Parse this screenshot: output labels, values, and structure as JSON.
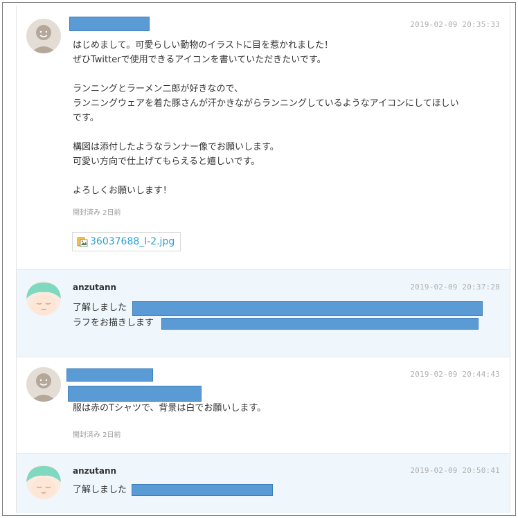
{
  "messages": [
    {
      "avatar": "default-user-avatar",
      "timestamp": "2019-02-09 20:35:33",
      "body": "はじめまして。可愛らしい動物のイラストに目を惹かれました！\nぜひTwitterで使用できるアイコンを書いていただきたいです。\n\nランニングとラーメン二郎が好きなので、\nランニングウェアを着た豚さんが汗かきながらランニングしているようなアイコンにしてほしい\nです。\n\n構図は添付したようなランナー像でお願いします。\n可愛い方向で仕上げてもらえると嬉しいです。\n\nよろしくお願いします！",
      "read_status": "開封済み 2日前",
      "attachment": {
        "icon": "image-file-icon",
        "filename": "36037688_l-2.jpg"
      }
    },
    {
      "avatar": "anzutann-avatar",
      "username": "anzutann",
      "timestamp": "2019-02-09 20:37:28",
      "lines": [
        "了解しました",
        "ラフをお描きします"
      ]
    },
    {
      "avatar": "default-user-avatar",
      "timestamp": "2019-02-09 20:44:43",
      "body": "服は赤のTシャツで、背景は白でお願いします。",
      "read_status": "開封済み 2日前"
    },
    {
      "avatar": "anzutann-avatar",
      "username": "anzutann",
      "timestamp": "2019-02-09 20:50:41",
      "lines": [
        "了解しました"
      ]
    }
  ],
  "colors": {
    "redaction": "#5b9bd5",
    "reply_background": "#eff7fc",
    "link": "#2a9fd6",
    "timestamp": "#b0b0b0"
  }
}
